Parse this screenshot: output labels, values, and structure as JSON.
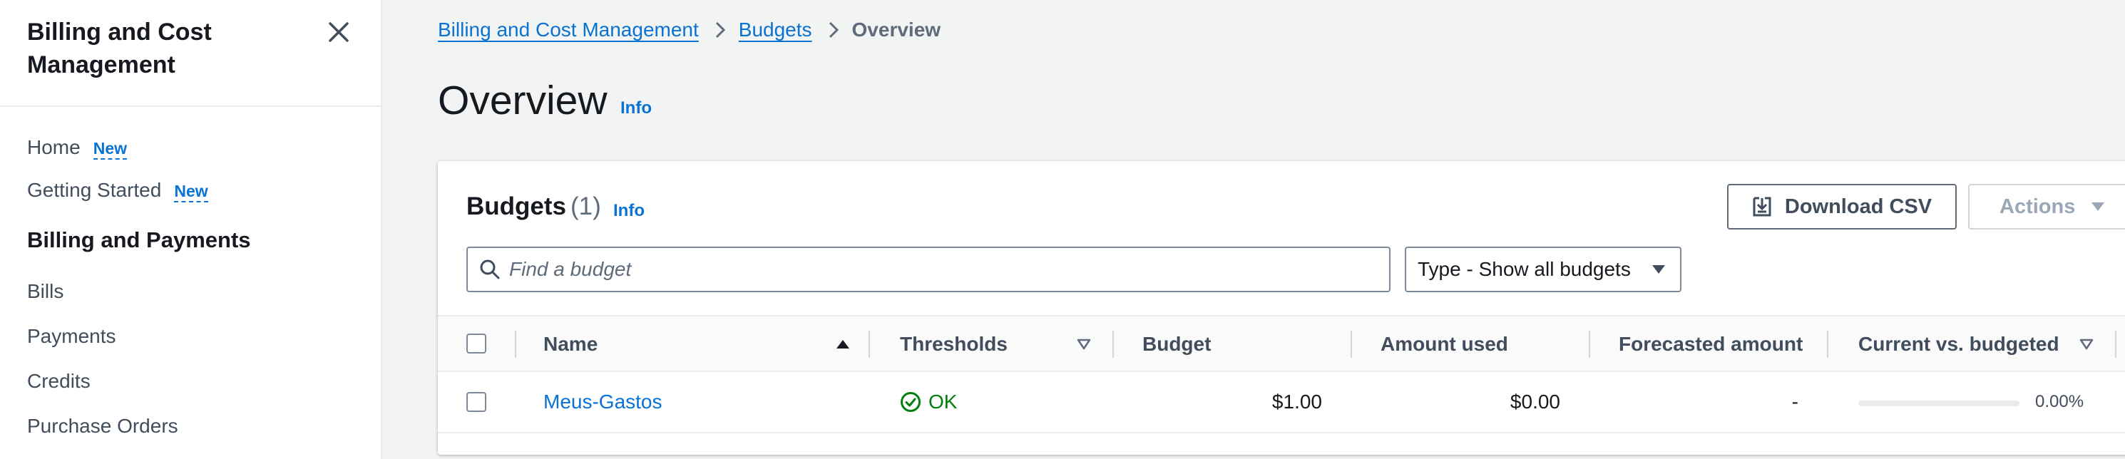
{
  "sidebar": {
    "title": "Billing and Cost Management",
    "items": [
      {
        "label": "Home",
        "badge": "New"
      },
      {
        "label": "Getting Started",
        "badge": "New"
      }
    ],
    "section": "Billing and Payments",
    "section_items": [
      "Bills",
      "Payments",
      "Credits",
      "Purchase Orders"
    ]
  },
  "breadcrumb": [
    "Billing and Cost Management",
    "Budgets",
    "Overview"
  ],
  "page": {
    "title": "Overview",
    "info": "Info"
  },
  "budgets_table": {
    "heading": "Budgets",
    "count": "(1)",
    "info": "Info",
    "download_label": "Download CSV",
    "actions_label": "Actions",
    "search_placeholder": "Find a budget",
    "type_filter": "Type - Show all budgets",
    "columns": [
      "Name",
      "Thresholds",
      "Budget",
      "Amount used",
      "Forecasted amount",
      "Current vs. budgeted"
    ],
    "rows": [
      {
        "name": "Meus-Gastos",
        "thresholds": "OK",
        "budget": "$1.00",
        "amount_used": "$0.00",
        "forecasted": "-",
        "current_vs_budgeted": "0.00%",
        "current_vs_budgeted_fraction": 0.0
      }
    ]
  },
  "colors": {
    "link": "#0972d3",
    "success": "#037f0c",
    "background": "#f2f3f3"
  }
}
